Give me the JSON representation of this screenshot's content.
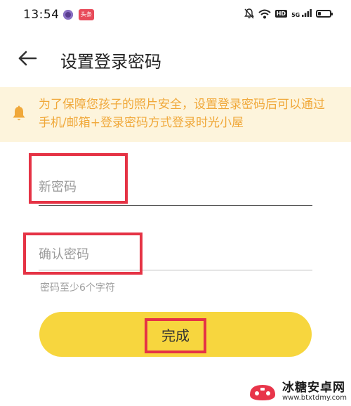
{
  "status_bar": {
    "time": "13:54",
    "app_badge": "头条",
    "hd": "HD",
    "signal": "5G"
  },
  "header": {
    "title": "设置登录密码"
  },
  "notice": {
    "text": "为了保障您孩子的照片安全，设置登录密码后可以通过手机/邮箱+登录密码方式登录时光小屋"
  },
  "form": {
    "new_password": {
      "placeholder": "新密码",
      "value": ""
    },
    "confirm_password": {
      "placeholder": "确认密码",
      "value": ""
    },
    "hint": "密码至少6个字符",
    "submit_label": "完成"
  },
  "colors": {
    "accent_yellow": "#f7d63e",
    "notice_bg": "#fdf4dc",
    "notice_text": "#f0a83a",
    "highlight_red": "#e53345"
  },
  "watermark": {
    "name": "冰糖安卓网",
    "url": "www.btxtdmy.com"
  }
}
